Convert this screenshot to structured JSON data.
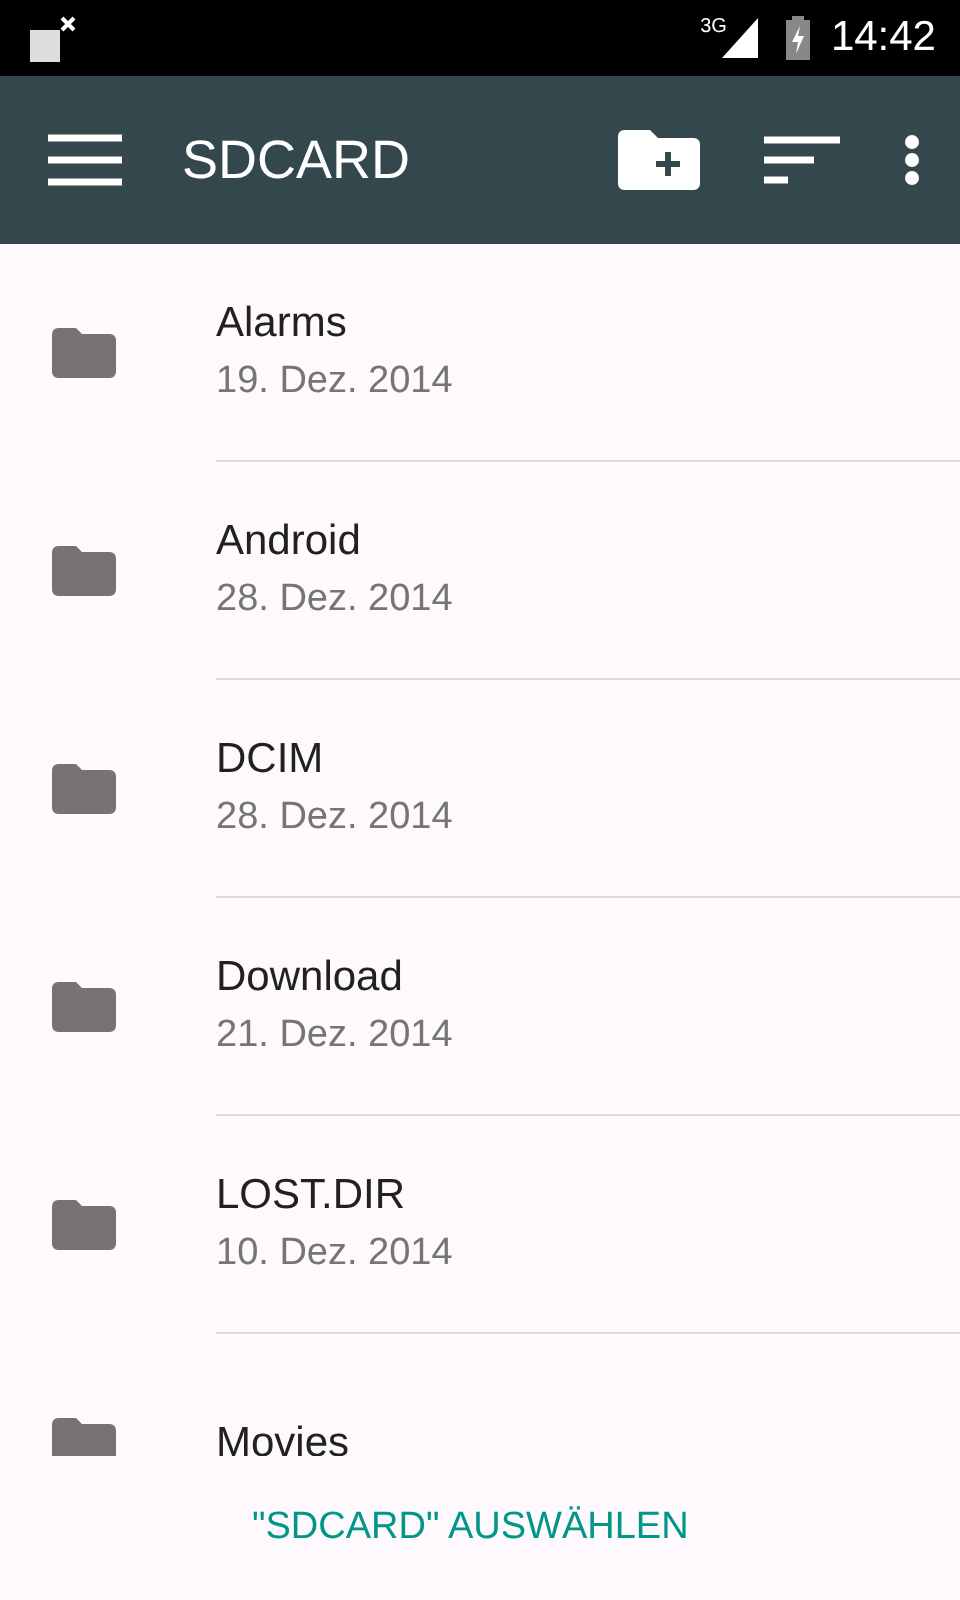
{
  "status_bar": {
    "network": "3G",
    "time": "14:42"
  },
  "app_bar": {
    "title": "SDCARD"
  },
  "folders": [
    {
      "name": "Alarms",
      "date": "19. Dez. 2014"
    },
    {
      "name": "Android",
      "date": "28. Dez. 2014"
    },
    {
      "name": "DCIM",
      "date": "28. Dez. 2014"
    },
    {
      "name": "Download",
      "date": "21. Dez. 2014"
    },
    {
      "name": "LOST.DIR",
      "date": "10. Dez. 2014"
    },
    {
      "name": "Movies"
    }
  ],
  "select_button": "\"SDCARD\" AUSWÄHLEN"
}
